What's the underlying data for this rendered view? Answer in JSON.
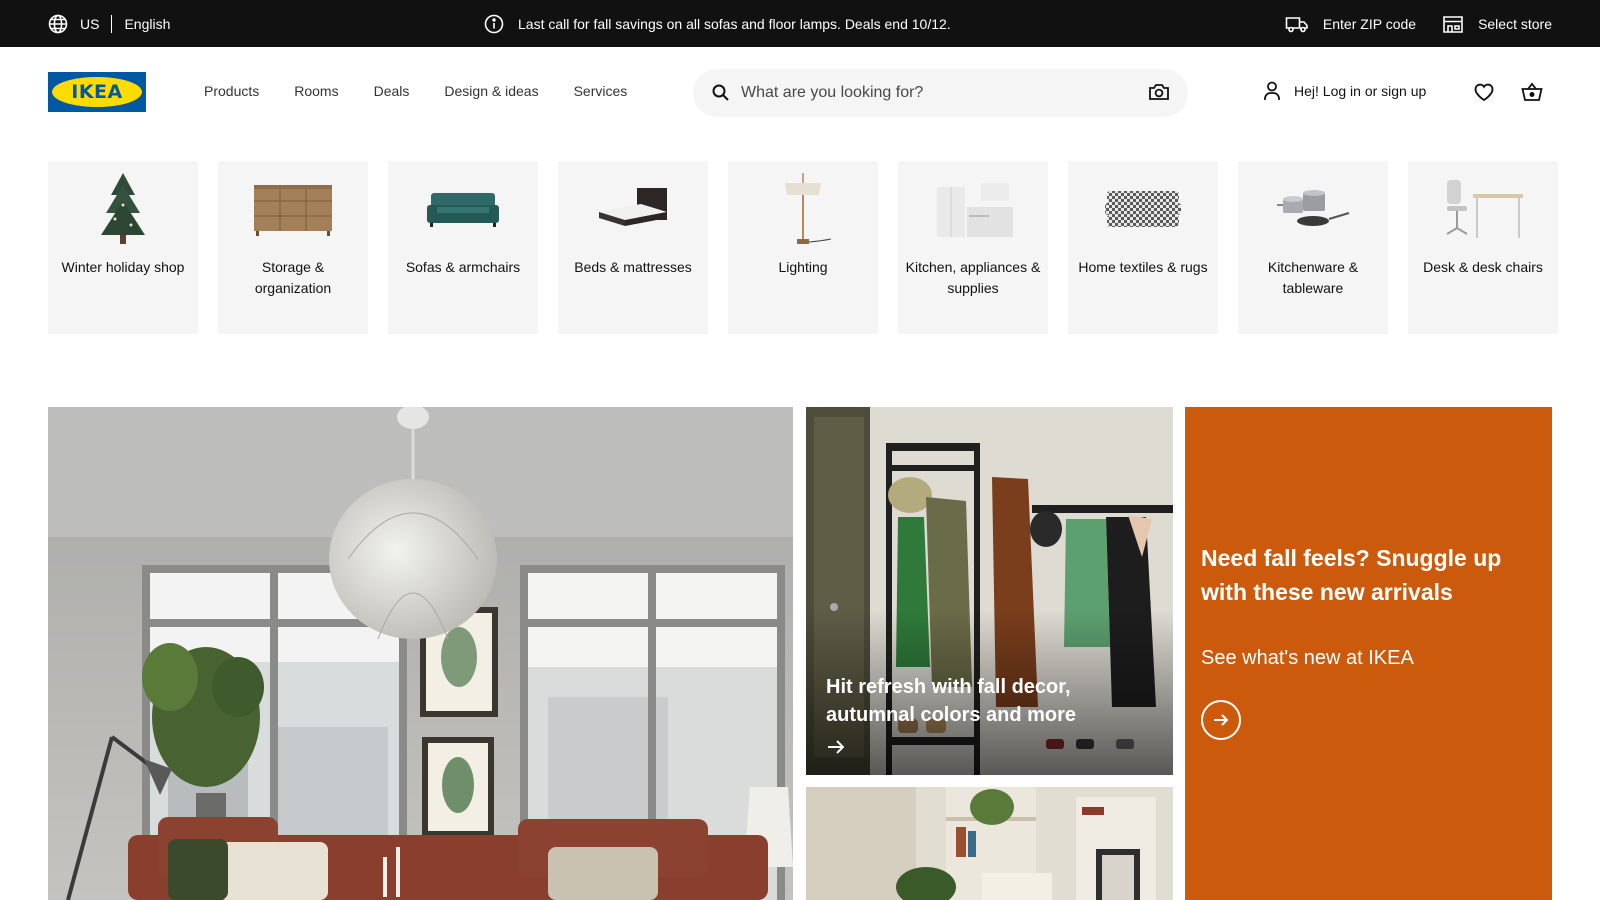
{
  "topbar": {
    "country": "US",
    "language": "English",
    "promo": "Last call for fall savings on all sofas and floor lamps. Deals end 10/12.",
    "zip_label": "Enter ZIP code",
    "store_label": "Select store",
    "icons": [
      "globe-icon",
      "info-icon",
      "truck-icon",
      "store-icon"
    ]
  },
  "header": {
    "logo_text": "IKEA",
    "nav": [
      "Products",
      "Rooms",
      "Deals",
      "Design & ideas",
      "Services"
    ],
    "search": {
      "placeholder": "What are you looking for?",
      "value": ""
    },
    "account_label": "Hej! Log in or sign up",
    "icons": [
      "search-icon",
      "camera-icon",
      "person-icon",
      "heart-icon",
      "cart-icon"
    ]
  },
  "categories": [
    {
      "label": "Winter holiday shop"
    },
    {
      "label": "Storage & organization"
    },
    {
      "label": "Sofas & armchairs"
    },
    {
      "label": "Beds & mattresses"
    },
    {
      "label": "Lighting"
    },
    {
      "label": "Kitchen, appliances & supplies"
    },
    {
      "label": "Home textiles & rugs"
    },
    {
      "label": "Kitchenware & tableware"
    },
    {
      "label": "Desk & desk chairs"
    }
  ],
  "hero": {
    "mid_caption": "Hit refresh with fall decor, autumnal colors and more",
    "orange_title": "Need fall feels? Snuggle up with these new arrivals",
    "orange_subtitle": "See what's new at IKEA"
  },
  "colors": {
    "topbar_bg": "#111111",
    "brand_blue": "#0058a3",
    "brand_yellow": "#ffdb00",
    "orange_card": "#cc5a0c",
    "tile_bg": "#f5f5f5"
  }
}
